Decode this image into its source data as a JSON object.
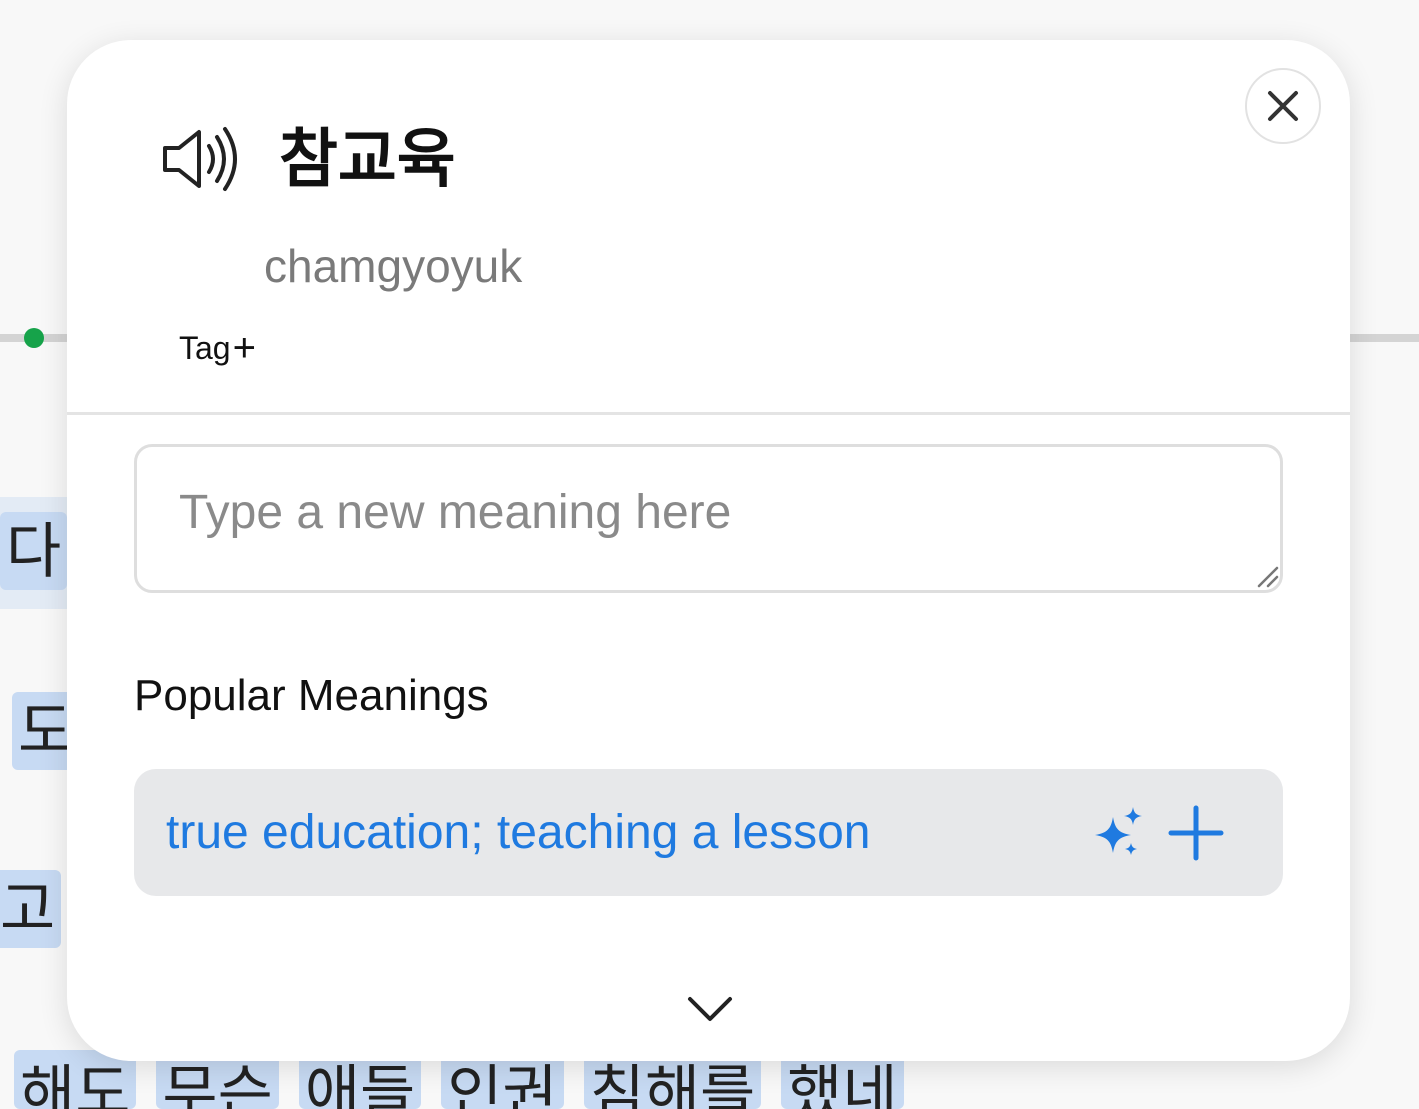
{
  "background": {
    "words": [
      "다",
      "도",
      "고"
    ],
    "bottom_words": [
      "해도",
      "무슨",
      "애들",
      "인권",
      "침해를",
      "했네"
    ]
  },
  "popup": {
    "word": "참교육",
    "romanization": "chamgyoyuk",
    "tag_label": "Tag",
    "tag_plus": "+",
    "meaning_input": {
      "placeholder": "Type a new meaning here",
      "value": ""
    },
    "popular_title": "Popular Meanings",
    "popular_meanings": [
      {
        "text": "true education; teaching a lesson"
      }
    ]
  },
  "colors": {
    "accent_blue": "#1f7ae0",
    "highlight": "#c7daf3",
    "status_dot": "#16a34a"
  },
  "icons": [
    "speaker-icon",
    "close-icon",
    "sparkle-icon",
    "plus-icon",
    "chevron-down-icon",
    "resize-grip-icon"
  ]
}
